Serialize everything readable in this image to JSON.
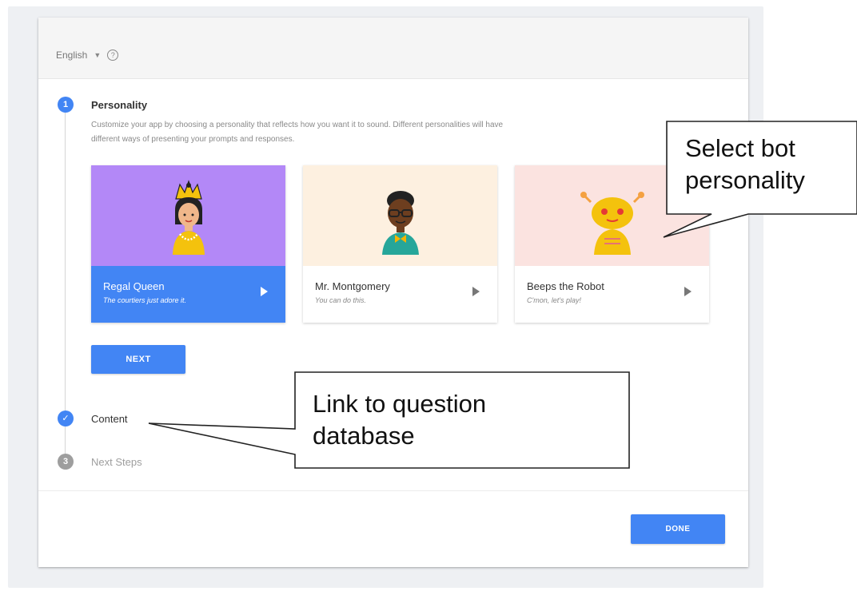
{
  "header": {
    "language": "English",
    "help_symbol": "?"
  },
  "steps": [
    {
      "number": "1",
      "title": "Personality",
      "description": "Customize your app by choosing a personality that reflects how you want it to sound. Different personalities will have different ways of presenting your prompts and responses."
    },
    {
      "number": "✓",
      "title": "Content"
    },
    {
      "number": "3",
      "title": "Next Steps"
    }
  ],
  "personalities": [
    {
      "name": "Regal Queen",
      "tagline": "The courtiers just adore it.",
      "selected": true
    },
    {
      "name": "Mr. Montgomery",
      "tagline": "You can do this.",
      "selected": false
    },
    {
      "name": "Beeps the Robot",
      "tagline": "C'mon, let's play!",
      "selected": false
    }
  ],
  "buttons": {
    "next": "NEXT",
    "done": "DONE"
  },
  "callouts": {
    "personality": [
      "Select bot",
      "personality"
    ],
    "content": [
      "Link to question",
      "database"
    ]
  },
  "colors": {
    "primary": "#4285f4",
    "queen_bg": "#b388f7",
    "montgomery_bg": "#fdf0e0",
    "robot_bg": "#fbe3e0"
  }
}
